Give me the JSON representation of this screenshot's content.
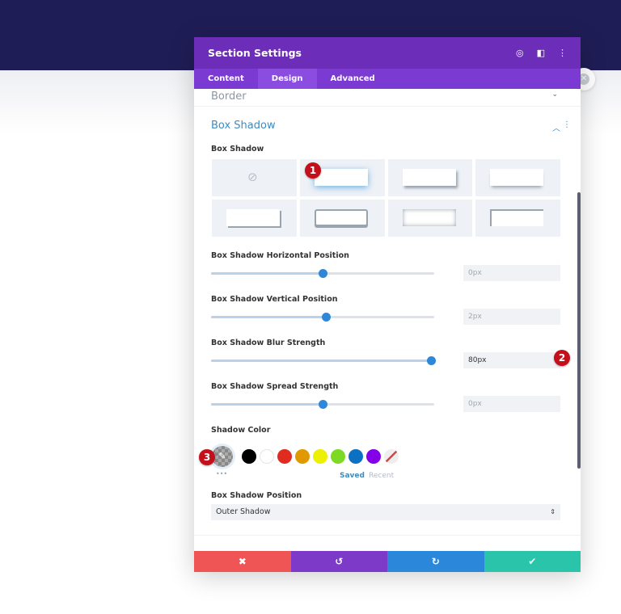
{
  "modal": {
    "title": "Section Settings",
    "header_icons": [
      "focus-icon",
      "split-view-icon",
      "more-icon"
    ]
  },
  "tabs": [
    {
      "label": "Content"
    },
    {
      "label": "Design",
      "active": true
    },
    {
      "label": "Advanced"
    }
  ],
  "border_section": {
    "title": "Border"
  },
  "box_shadow": {
    "title": "Box Shadow",
    "preset_label": "Box Shadow",
    "selected_preset": 1,
    "horizontal": {
      "label": "Box Shadow Horizontal Position",
      "value": "0px",
      "slider": 0.5
    },
    "vertical": {
      "label": "Box Shadow Vertical Position",
      "value": "2px",
      "slider": 0.515
    },
    "blur": {
      "label": "Box Shadow Blur Strength",
      "value": "80px",
      "slider": 0.985
    },
    "spread": {
      "label": "Box Shadow Spread Strength",
      "value": "0px",
      "slider": 0.5
    },
    "color": {
      "label": "Shadow Color",
      "swatches": [
        "#000000",
        "#ffffff",
        "#e02b20",
        "#e09900",
        "#edf000",
        "#7cda24",
        "#0c71c3",
        "#8300e9"
      ],
      "saved": "Saved",
      "recent": "Recent",
      "more": "•••"
    },
    "position": {
      "label": "Box Shadow Position",
      "value": "Outer Shadow"
    }
  },
  "badges": [
    "1",
    "2",
    "3"
  ],
  "footer": {
    "cancel": "✖",
    "undo": "↺",
    "redo": "↻",
    "save": "✔"
  },
  "colors": {
    "header": "#6c2eb9",
    "accent": "#2e87d7",
    "cancel": "#ef5555",
    "undo": "#7d3ac9",
    "redo": "#2b87da",
    "save": "#29c4a9"
  }
}
